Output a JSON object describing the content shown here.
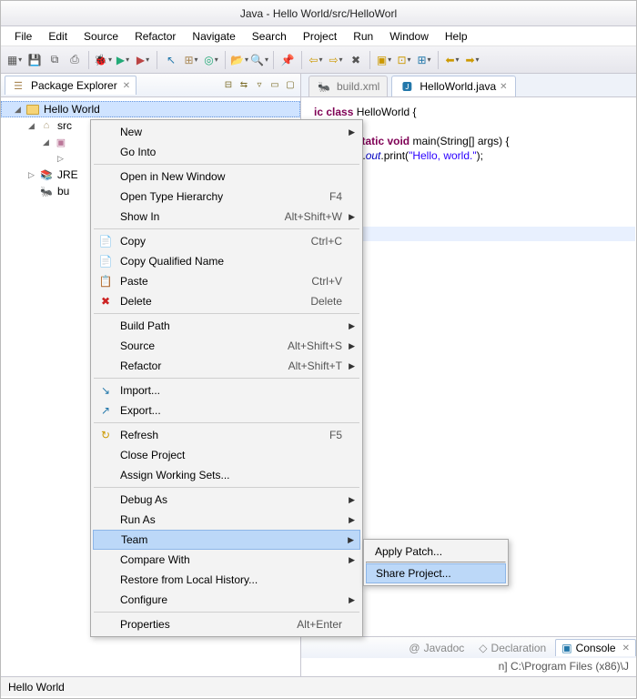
{
  "title": "Java - Hello World/src/HelloWorl",
  "menu": [
    "File",
    "Edit",
    "Source",
    "Refactor",
    "Navigate",
    "Search",
    "Project",
    "Run",
    "Window",
    "Help"
  ],
  "explorer": {
    "title": "Package Explorer",
    "nodes": {
      "project": "Hello World",
      "src": "src",
      "jre": "JRE",
      "build": "bu"
    }
  },
  "tabs": {
    "inactive": "build.xml",
    "active": "HelloWorld.java"
  },
  "code": {
    "l1a": "ic class",
    "l1b": " HelloWorld {",
    "l2a": "ublic static void",
    "l2b": " main(String[] args) {",
    "l3a": "    System.",
    "l3b": "out",
    "l3c": ".print(",
    "l3d": "\"Hello, world.\"",
    "l3e": ");",
    "l4": "}"
  },
  "bottom": {
    "tabs": [
      "Javadoc",
      "Declaration",
      "Console"
    ],
    "console_sub": "n] C:\\Program Files (x86)\\J"
  },
  "status": "Hello World",
  "ctx": {
    "new": "New",
    "goto": "Go Into",
    "openwin": "Open in New Window",
    "typeh": "Open Type Hierarchy",
    "typeh_sc": "F4",
    "showin": "Show In",
    "showin_sc": "Alt+Shift+W",
    "copy": "Copy",
    "copy_sc": "Ctrl+C",
    "copyq": "Copy Qualified Name",
    "paste": "Paste",
    "paste_sc": "Ctrl+V",
    "delete": "Delete",
    "delete_sc": "Delete",
    "build": "Build Path",
    "source": "Source",
    "source_sc": "Alt+Shift+S",
    "refactor": "Refactor",
    "refactor_sc": "Alt+Shift+T",
    "import": "Import...",
    "export": "Export...",
    "refresh": "Refresh",
    "refresh_sc": "F5",
    "close": "Close Project",
    "assign": "Assign Working Sets...",
    "debug": "Debug As",
    "run": "Run As",
    "team": "Team",
    "compare": "Compare With",
    "restore": "Restore from Local History...",
    "config": "Configure",
    "props": "Properties",
    "props_sc": "Alt+Enter"
  },
  "sub": {
    "apply": "Apply Patch...",
    "share": "Share Project..."
  }
}
